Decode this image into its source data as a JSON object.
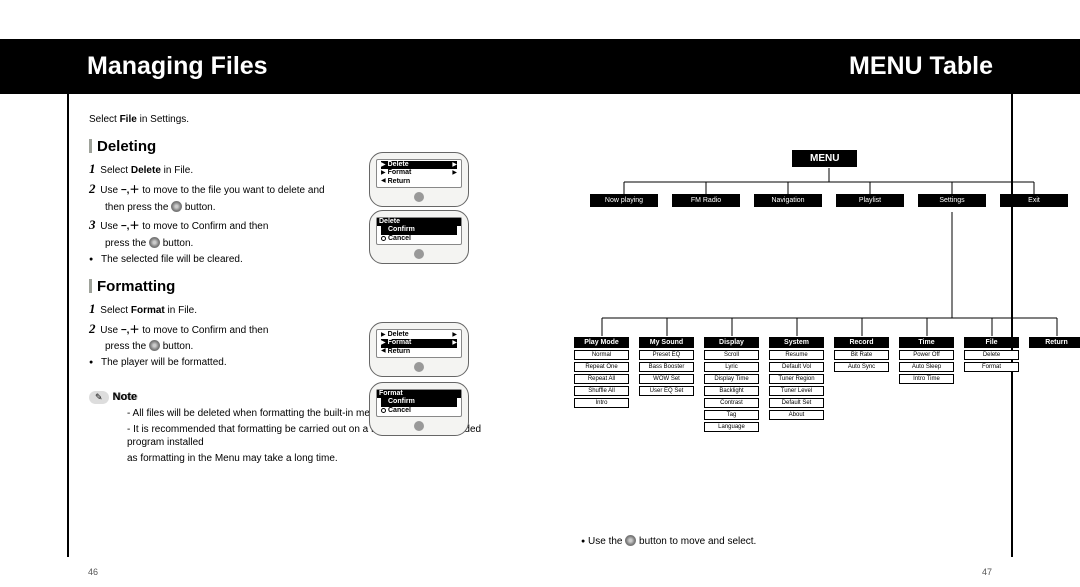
{
  "page_left_num": "46",
  "page_right_num": "47",
  "header_left": "Managing Files",
  "header_right": "MENU Table",
  "intro_prefix": "Select ",
  "intro_bold": "File",
  "intro_suffix": " in Settings.",
  "deleting": {
    "heading": "Deleting",
    "s1_prefix": "Select ",
    "s1_bold": "Delete",
    "s1_suffix": " in File.",
    "s2a": "Use ",
    "s2_sym": "−,＋",
    "s2b": " to move to the file you want to delete and",
    "s2c": "then press the ",
    "s2d": " button.",
    "s3a": "Use ",
    "s3b": " to move to Confirm and then",
    "s3c": "press the ",
    "s3d": " button.",
    "bullet": "The selected file will be cleared."
  },
  "formatting": {
    "heading": "Formatting",
    "s1_prefix": "Select ",
    "s1_bold": "Format",
    "s1_suffix": " in File.",
    "s2a": "Use ",
    "s2_sym": "−,＋",
    "s2b": " to move to Confirm and then",
    "s2c": "press the ",
    "s2d": " button.",
    "bullet": "The player will be formatted."
  },
  "note": {
    "label": "Note",
    "l1": "- All files will be deleted when formatting the built-in memory.",
    "l2": "- It is recommended that formatting be carried out on a PC that has the provided program installed",
    "l3": "  as formatting in the Menu may take a long time."
  },
  "device": {
    "d1_t": "",
    "d1_r": [
      "▶ Delete",
      "▶ Format",
      "◀ Return"
    ],
    "d1_sel": 0,
    "d2_title": "Delete",
    "d2_r": [
      "Confirm",
      "Cancel"
    ],
    "d2_sel": 0,
    "d3_r": [
      "▶ Delete",
      "▶ Format",
      "◀ Return"
    ],
    "d3_sel": 1,
    "d4_title": "Format",
    "d4_r": [
      "Confirm",
      "Cancel"
    ],
    "d4_sel": 0
  },
  "menu": {
    "root": "MENU",
    "level1": [
      "Now playing",
      "FM Radio",
      "Navigation",
      "Playlist",
      "Settings",
      "Exit"
    ],
    "level2": [
      {
        "h": "Play Mode",
        "items": [
          "Normal",
          "Repeat One",
          "Repeat All",
          "Shuffle All",
          "Intro"
        ]
      },
      {
        "h": "My Sound",
        "items": [
          "Preset EQ",
          "Bass Booster",
          "WOW Set",
          "User EQ Set"
        ]
      },
      {
        "h": "Display",
        "items": [
          "Scroll",
          "Lyric",
          "Display Time",
          "Backlight",
          "Contrast",
          "Tag",
          "Language"
        ]
      },
      {
        "h": "System",
        "items": [
          "Resume",
          "Default Vol",
          "Tuner Region",
          "Tuner Level",
          "Default Set",
          "About"
        ]
      },
      {
        "h": "Record",
        "items": [
          "Bit Rate",
          "Auto Sync"
        ]
      },
      {
        "h": "Time",
        "items": [
          "Power Off",
          "Auto Sleep",
          "Intro Time"
        ]
      },
      {
        "h": "File",
        "items": [
          "Delete",
          "Format"
        ]
      },
      {
        "h": "Return",
        "items": []
      }
    ]
  },
  "legend_a": "Use the ",
  "legend_b": " button to move and select."
}
